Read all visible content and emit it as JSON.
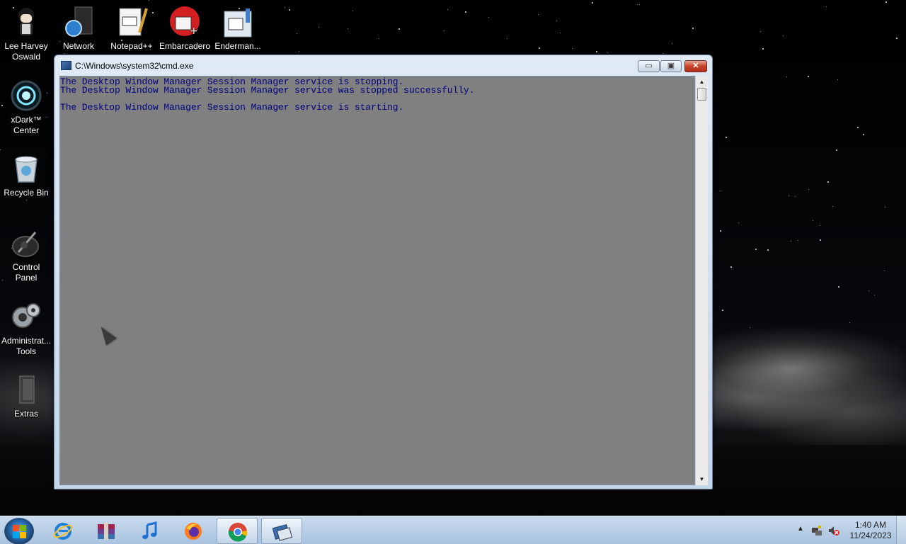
{
  "desktop": {
    "icons": [
      {
        "label_line1": "Lee Harvey",
        "label_line2": "Oswald",
        "icon": "user-figure-icon"
      },
      {
        "label_line1": "xDark™",
        "label_line2": "Center",
        "icon": "xdark-orb-icon"
      },
      {
        "label_line1": "Recycle Bin",
        "label_line2": "",
        "icon": "recycle-bin-icon"
      },
      {
        "label_line1": "Control",
        "label_line2": "Panel",
        "icon": "control-panel-icon"
      },
      {
        "label_line1": "Administrat...",
        "label_line2": "Tools",
        "icon": "admin-tools-icon"
      },
      {
        "label_line1": "Extras",
        "label_line2": "",
        "icon": "folder-icon"
      }
    ],
    "top_icons": [
      {
        "label": "Network",
        "icon": "network-icon"
      },
      {
        "label": "Notepad++",
        "icon": "notepad-plus-plus-icon"
      },
      {
        "label": "Embarcadero",
        "icon": "embarcadero-icon"
      },
      {
        "label": "Enderman...",
        "icon": "application-icon"
      }
    ]
  },
  "window": {
    "title": "C:\\Windows\\system32\\cmd.exe",
    "controls": {
      "minimize": "▭",
      "maximize": "▣",
      "close": "✕"
    },
    "console_lines": [
      "The Desktop Window Manager Session Manager service is stopping.",
      "The Desktop Window Manager Session Manager service was stopped successfully.",
      "",
      "The Desktop Window Manager Session Manager service is starting."
    ],
    "console_bg": "#808080",
    "console_fg": "#000080"
  },
  "taskbar": {
    "items": [
      {
        "name": "internet-explorer-icon",
        "active": false
      },
      {
        "name": "winrar-icon",
        "active": false
      },
      {
        "name": "itunes-icon",
        "active": false
      },
      {
        "name": "firefox-icon",
        "active": false
      },
      {
        "name": "chrome-icon",
        "active": true
      },
      {
        "name": "cmd-window-icon",
        "active": true
      }
    ],
    "tray": {
      "time": "1:40 AM",
      "date": "11/24/2023"
    }
  }
}
